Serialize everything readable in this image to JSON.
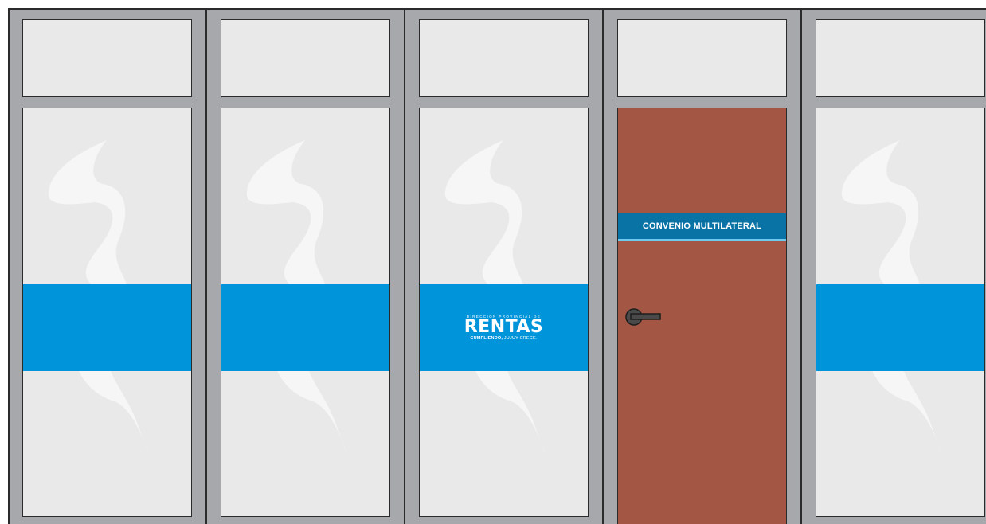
{
  "facade": {
    "frame_color": "#a6a8ab",
    "glass_color": "#e8e9e8",
    "stripe_color": "#0095db",
    "bays": [
      {
        "type": "glass-panel",
        "logo": false
      },
      {
        "type": "glass-panel",
        "logo": false
      },
      {
        "type": "glass-panel",
        "logo": true
      },
      {
        "type": "door"
      },
      {
        "type": "glass-panel",
        "logo": false
      }
    ]
  },
  "logo": {
    "top_line": "DIRECCIÓN PROVINCIAL DE",
    "main": "RENTAS",
    "tagline_bold": "CUMPLIENDO,",
    "tagline": "JUJUY CRECE."
  },
  "door": {
    "color": "#a35643",
    "sign_label": "CONVENIO MULTILATERAL",
    "sign_color": "#0a73a5",
    "sign_accent": "#6fc8ef",
    "handle_icon": "lever-handle-icon"
  }
}
